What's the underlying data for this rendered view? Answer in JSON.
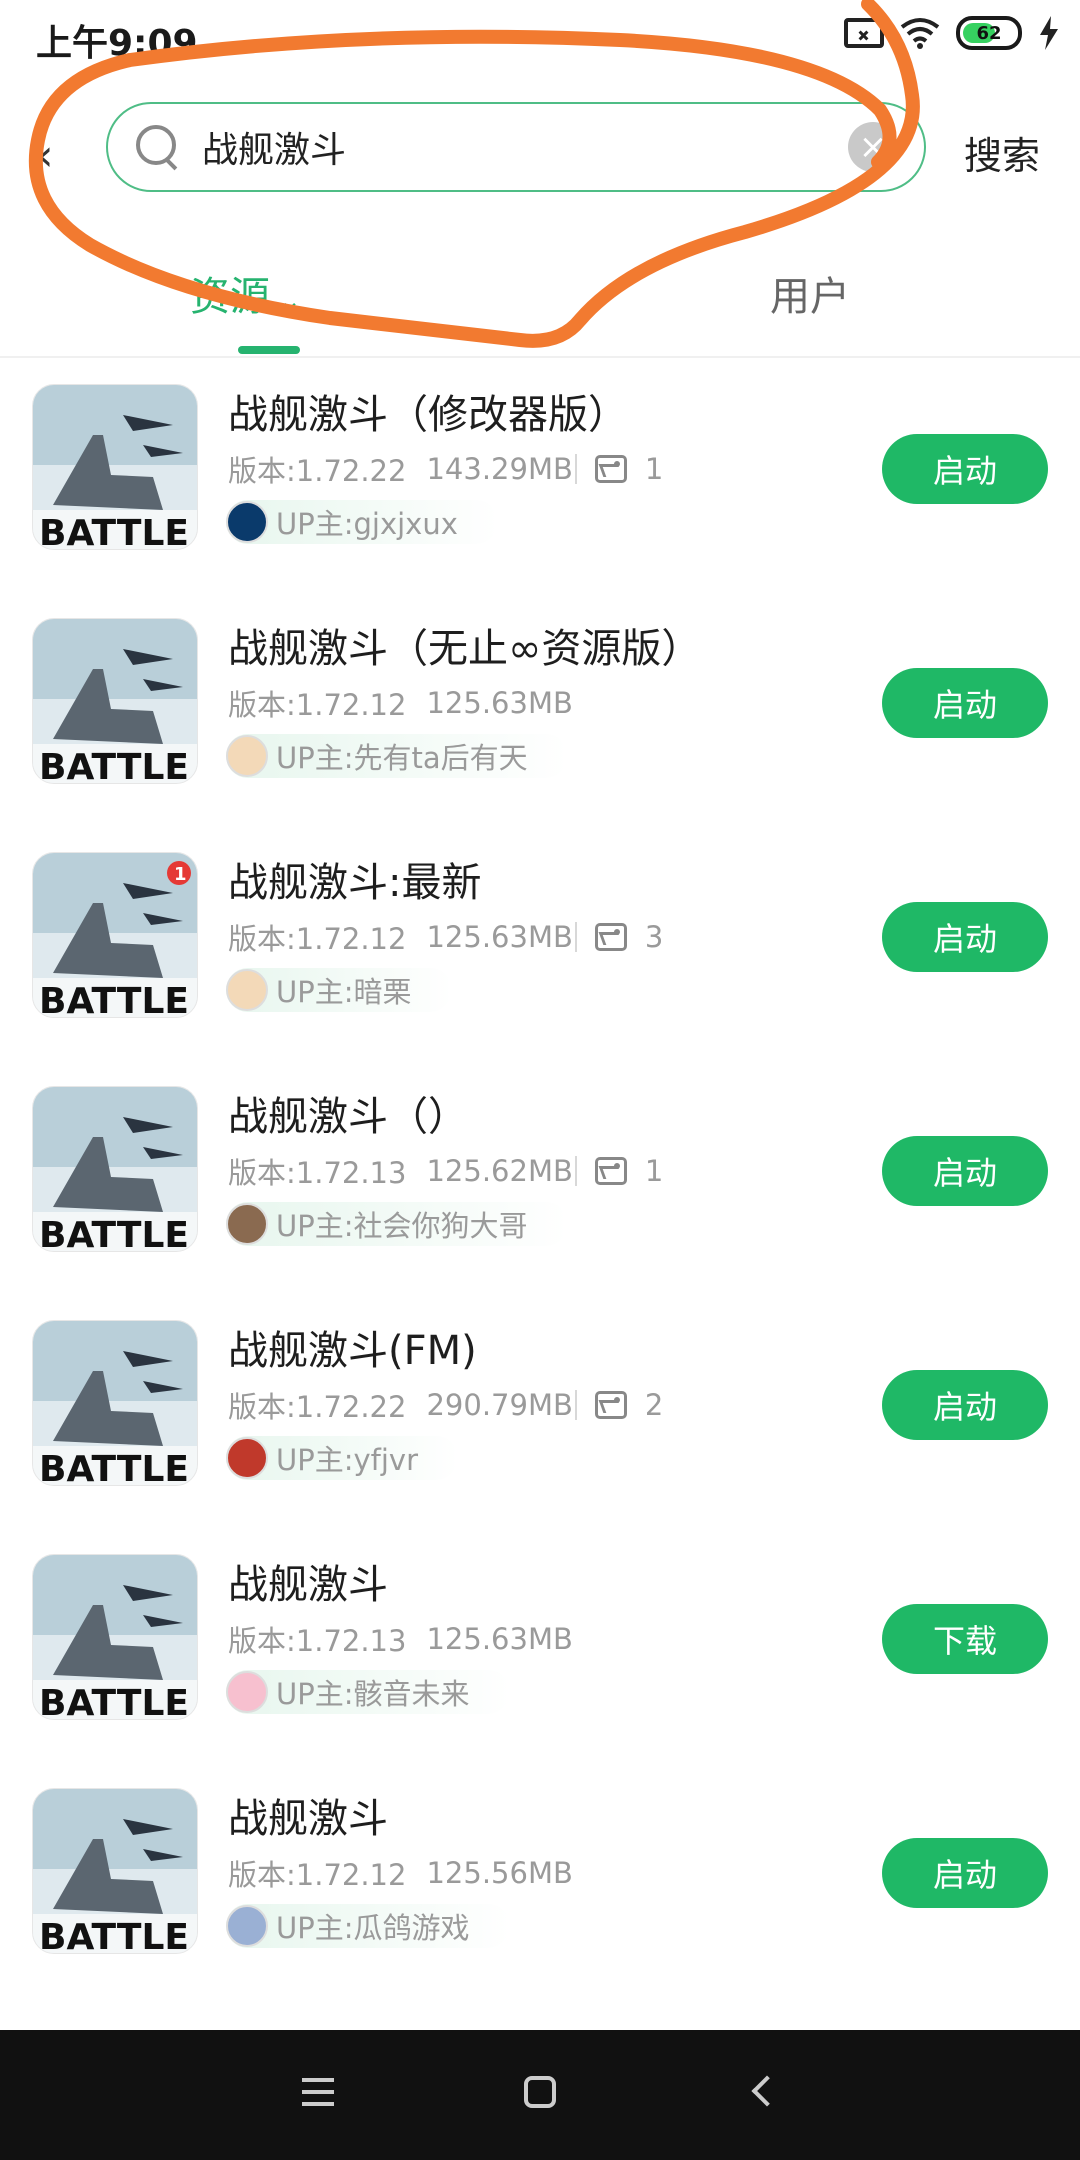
{
  "status_bar": {
    "time": "上午9:09",
    "battery": "62"
  },
  "header": {
    "search_value": "战舰激斗",
    "search_button": "搜索"
  },
  "tabs": [
    {
      "label": "资源"
    },
    {
      "label": "用户"
    }
  ],
  "colors": {
    "accent": "#1fb866",
    "annotation": "#f27a30"
  },
  "items": [
    {
      "title": "战舰激斗（修改器版）",
      "version": "版本:1.72.22",
      "size": "143.29MB",
      "images": "1",
      "uploader": "UP主:gjxjxux",
      "action": "启动"
    },
    {
      "title": "战舰激斗（无止∞资源版）",
      "version": "版本:1.72.12",
      "size": "125.63MB",
      "uploader": "UP主:先有ta后有天",
      "action": "启动"
    },
    {
      "title": "战舰激斗:最新",
      "version": "版本:1.72.12",
      "size": "125.63MB",
      "images": "3",
      "uploader": "UP主:暗栗",
      "action": "启动"
    },
    {
      "title": "战舰激斗（）",
      "version": "版本:1.72.13",
      "size": "125.62MB",
      "images": "1",
      "uploader": "UP主:社会你狗大哥",
      "action": "启动"
    },
    {
      "title": "战舰激斗(FM)",
      "version": "版本:1.72.22",
      "size": "290.79MB",
      "images": "2",
      "uploader": "UP主:yfjvr",
      "action": "启动"
    },
    {
      "title": "战舰激斗",
      "version": "版本:1.72.13",
      "size": "125.63MB",
      "uploader": "UP主:骸音未来",
      "action": "下载"
    },
    {
      "title": "战舰激斗",
      "version": "版本:1.72.12",
      "size": "125.56MB",
      "uploader": "UP主:瓜鸽游戏",
      "action": "启动"
    }
  ]
}
